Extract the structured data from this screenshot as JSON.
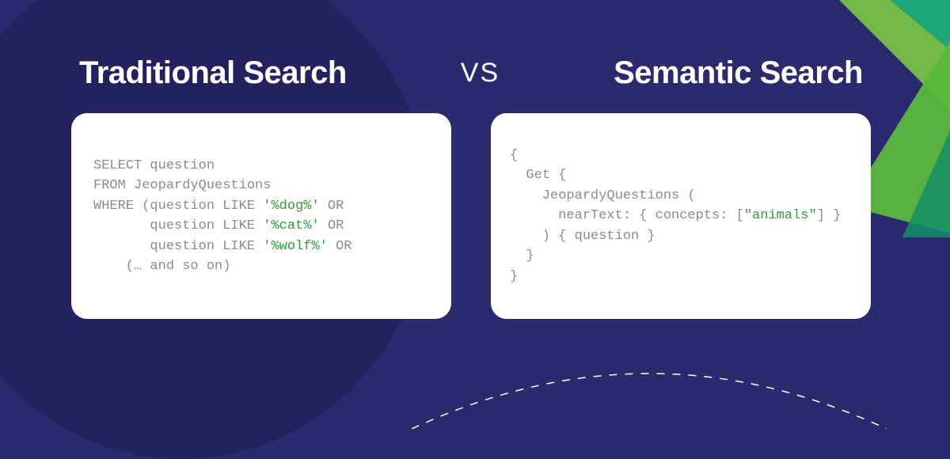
{
  "left": {
    "title": "Traditional Search",
    "code": {
      "line1": "SELECT question",
      "line2": "FROM JeopardyQuestions",
      "line3_pre": "WHERE (question LIKE ",
      "line3_str": "'%dog%'",
      "line3_post": " OR",
      "line4_pre": "       question LIKE ",
      "line4_str": "'%cat%'",
      "line4_post": " OR",
      "line5_pre": "       question LIKE ",
      "line5_str": "'%wolf%'",
      "line5_post": " OR",
      "line6": "    (… and so on)"
    }
  },
  "vs": "VS",
  "right": {
    "title": "Semantic Search",
    "code": {
      "line1": "{",
      "line2": "  Get {",
      "line3": "    JeopardyQuestions (",
      "line4_pre": "      nearText: { concepts: [",
      "line4_str": "\"animals\"",
      "line4_post": "] }",
      "line5": "    ) { question }",
      "line6": "  }",
      "line7": "}"
    }
  }
}
